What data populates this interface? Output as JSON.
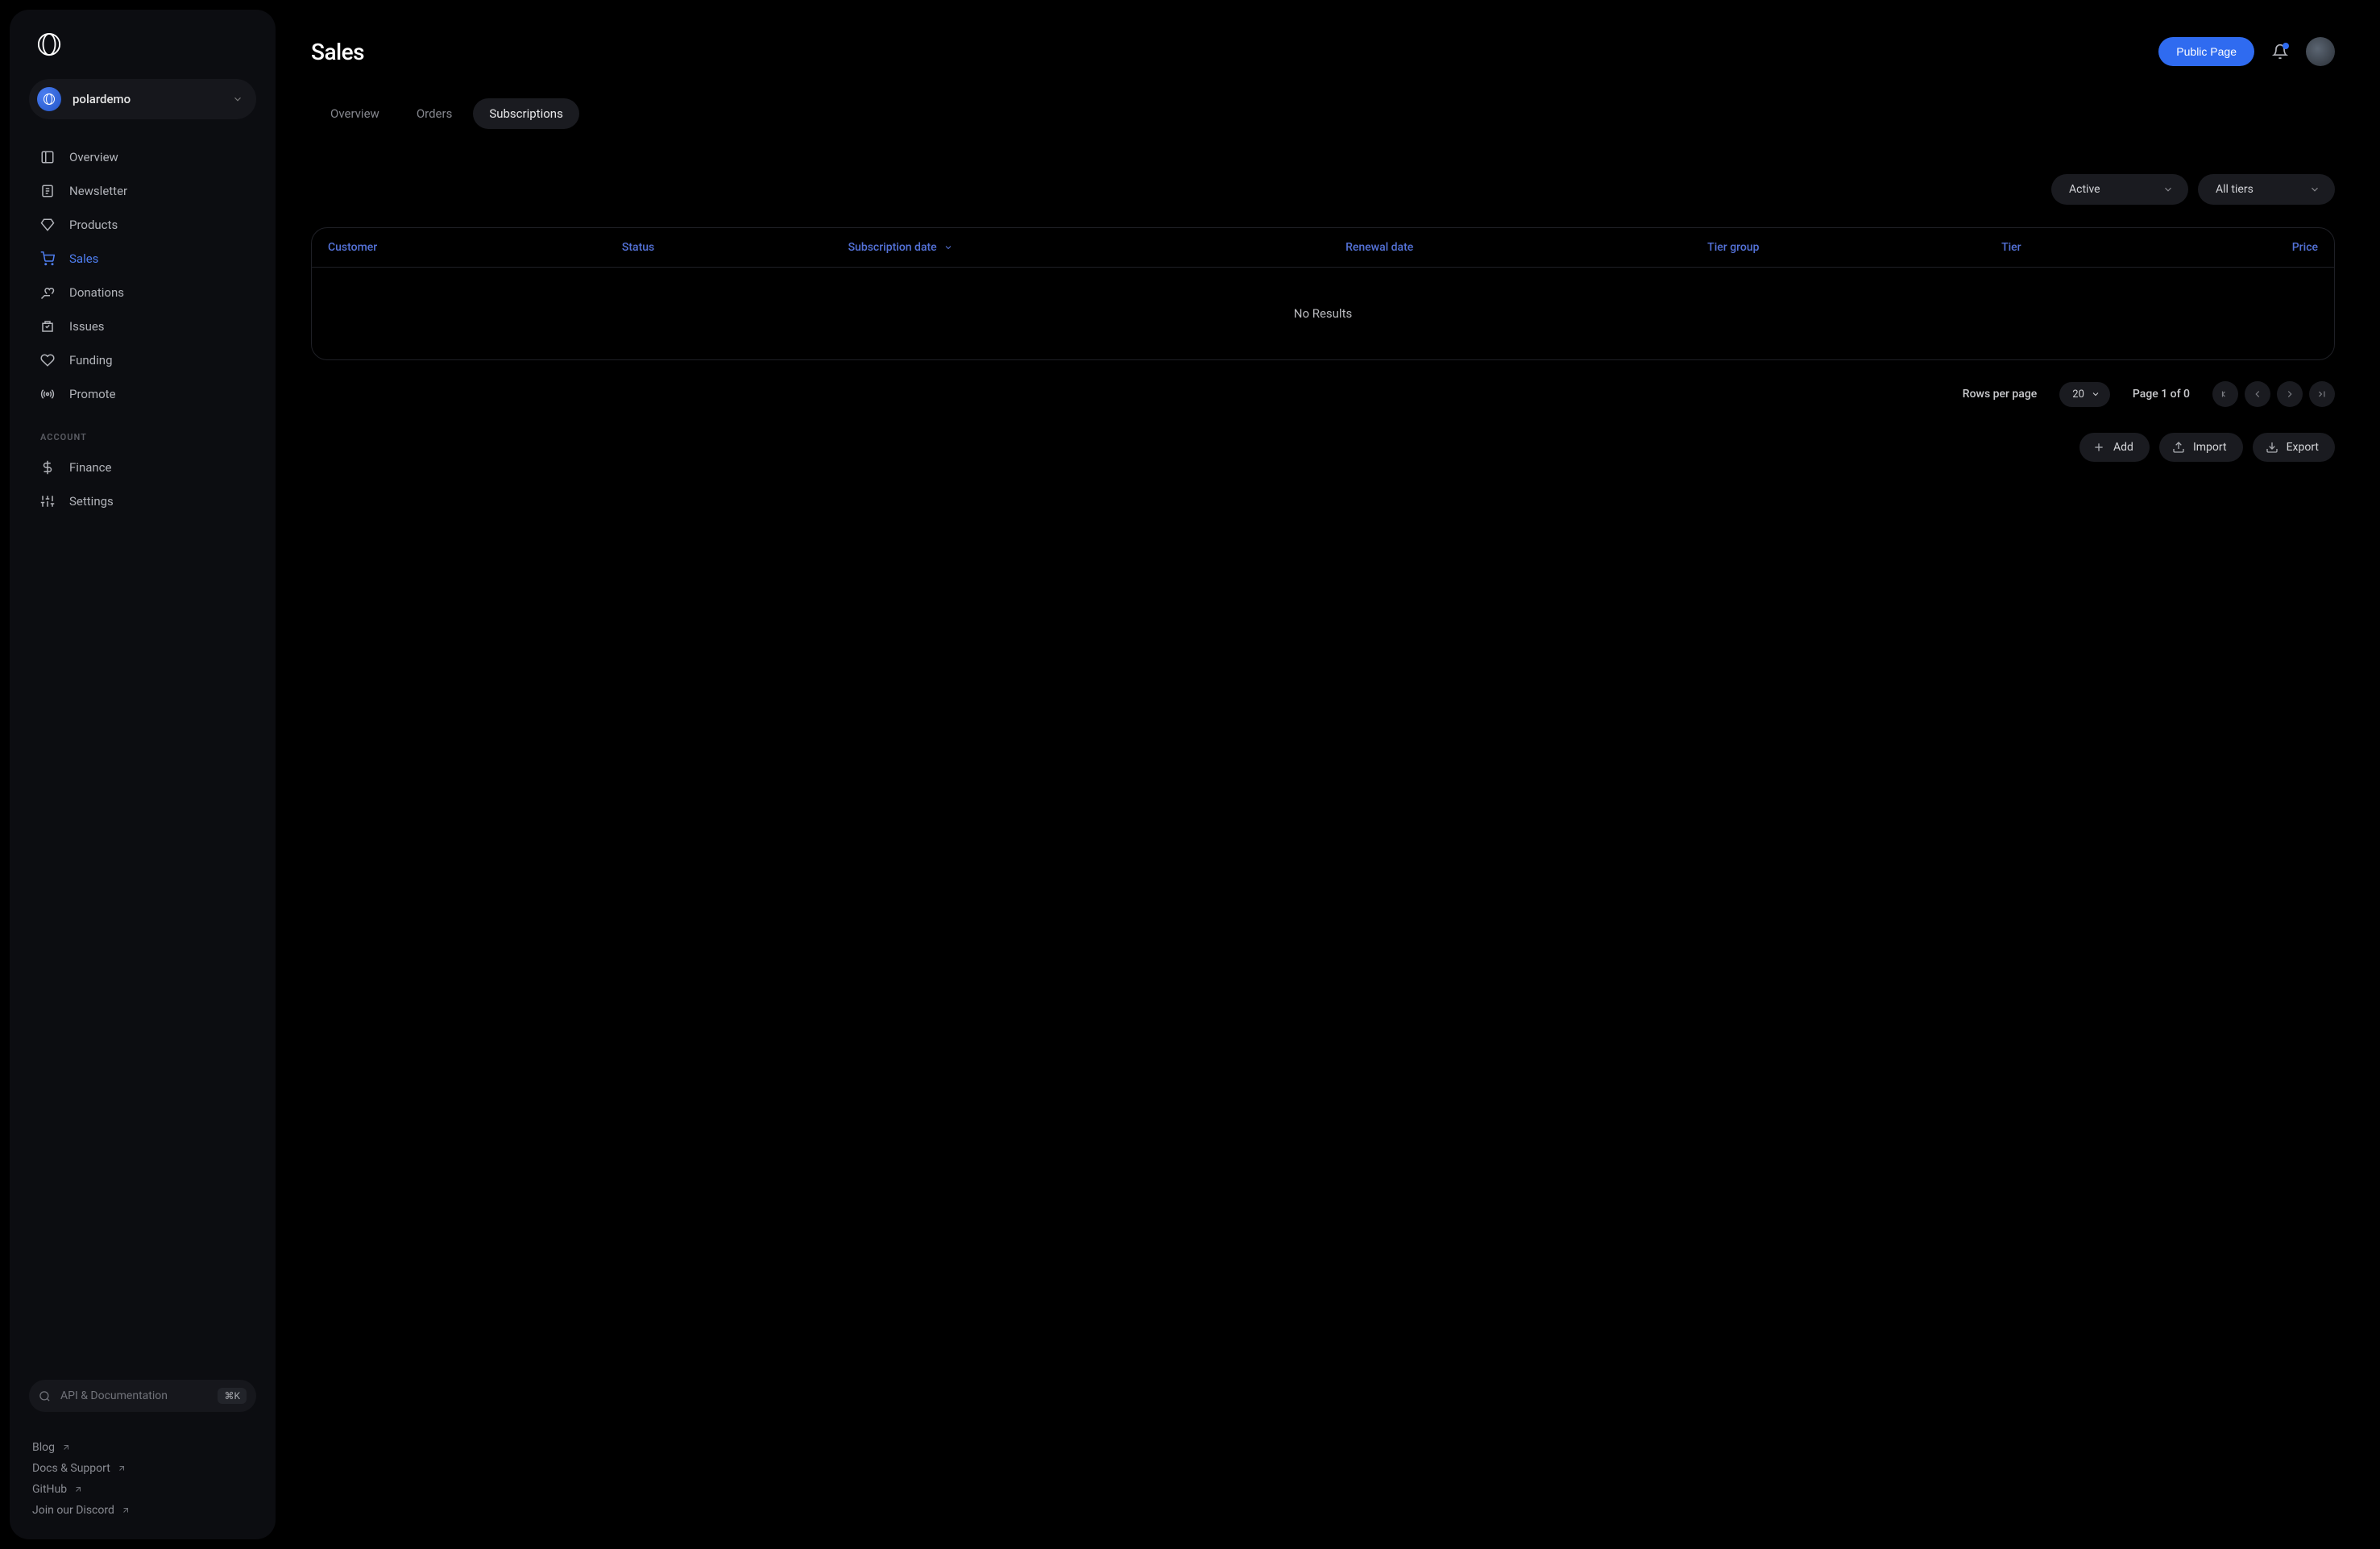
{
  "org": {
    "name": "polardemo"
  },
  "sidebar": {
    "items": [
      {
        "label": "Overview"
      },
      {
        "label": "Newsletter"
      },
      {
        "label": "Products"
      },
      {
        "label": "Sales"
      },
      {
        "label": "Donations"
      },
      {
        "label": "Issues"
      },
      {
        "label": "Funding"
      },
      {
        "label": "Promote"
      }
    ],
    "account_header": "Account",
    "account_items": [
      {
        "label": "Finance"
      },
      {
        "label": "Settings"
      }
    ],
    "search_placeholder": "API & Documentation",
    "search_shortcut": "⌘K",
    "footer": [
      {
        "label": "Blog"
      },
      {
        "label": "Docs & Support"
      },
      {
        "label": "GitHub"
      },
      {
        "label": "Join our Discord"
      }
    ]
  },
  "page": {
    "title": "Sales",
    "public_page_btn": "Public Page"
  },
  "tabs": [
    {
      "label": "Overview"
    },
    {
      "label": "Orders"
    },
    {
      "label": "Subscriptions"
    }
  ],
  "filters": {
    "status": "Active",
    "tier": "All tiers"
  },
  "table": {
    "columns": [
      "Customer",
      "Status",
      "Subscription date",
      "Renewal date",
      "Tier group",
      "Tier",
      "Price"
    ],
    "empty": "No Results"
  },
  "pager": {
    "rows_label": "Rows per page",
    "page_size": "20",
    "info": "Page 1 of 0"
  },
  "actions": {
    "add": "Add",
    "import": "Import",
    "export": "Export"
  }
}
